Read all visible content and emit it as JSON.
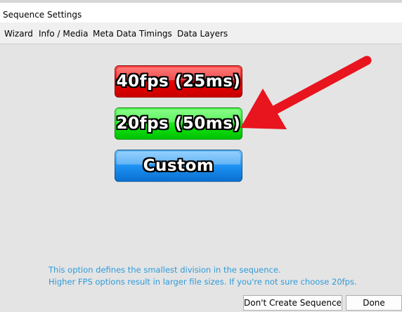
{
  "window": {
    "title": "Sequence Settings"
  },
  "tabs": [
    {
      "label": "Wizard"
    },
    {
      "label": "Info / Media"
    },
    {
      "label": "Meta Data"
    },
    {
      "label": "Timings"
    },
    {
      "label": "Data Layers"
    }
  ],
  "wizard": {
    "options": [
      {
        "label": "40fps (25ms)",
        "color": "#e60000"
      },
      {
        "label": "20fps (50ms)",
        "color": "#14e814"
      },
      {
        "label": "Custom",
        "color": "#1a8ff0"
      }
    ],
    "annotation_color": "#e8141e",
    "hint_line1": "This option defines the smallest division in the sequence.",
    "hint_line2": "Higher FPS options result in larger file sizes.  If you're not sure choose 20fps."
  },
  "footer": {
    "dont_create_label": "Don't Create Sequence",
    "done_label": "Done"
  }
}
